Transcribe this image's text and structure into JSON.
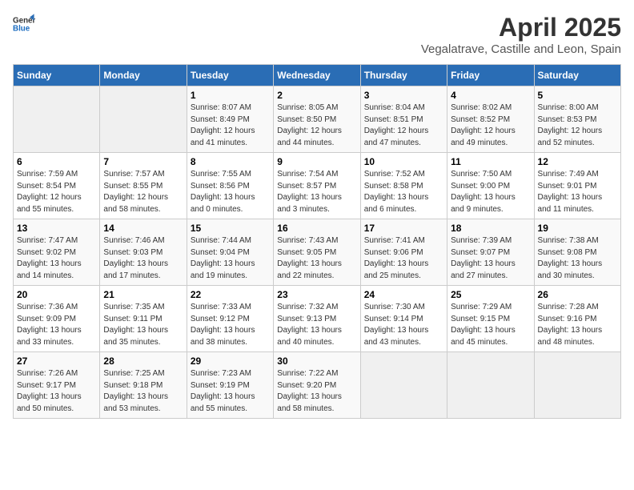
{
  "logo": {
    "general": "General",
    "blue": "Blue"
  },
  "header": {
    "month": "April 2025",
    "location": "Vegalatrave, Castille and Leon, Spain"
  },
  "weekdays": [
    "Sunday",
    "Monday",
    "Tuesday",
    "Wednesday",
    "Thursday",
    "Friday",
    "Saturday"
  ],
  "weeks": [
    [
      {
        "day": "",
        "sunrise": "",
        "sunset": "",
        "daylight": ""
      },
      {
        "day": "",
        "sunrise": "",
        "sunset": "",
        "daylight": ""
      },
      {
        "day": "1",
        "sunrise": "Sunrise: 8:07 AM",
        "sunset": "Sunset: 8:49 PM",
        "daylight": "Daylight: 12 hours and 41 minutes."
      },
      {
        "day": "2",
        "sunrise": "Sunrise: 8:05 AM",
        "sunset": "Sunset: 8:50 PM",
        "daylight": "Daylight: 12 hours and 44 minutes."
      },
      {
        "day": "3",
        "sunrise": "Sunrise: 8:04 AM",
        "sunset": "Sunset: 8:51 PM",
        "daylight": "Daylight: 12 hours and 47 minutes."
      },
      {
        "day": "4",
        "sunrise": "Sunrise: 8:02 AM",
        "sunset": "Sunset: 8:52 PM",
        "daylight": "Daylight: 12 hours and 49 minutes."
      },
      {
        "day": "5",
        "sunrise": "Sunrise: 8:00 AM",
        "sunset": "Sunset: 8:53 PM",
        "daylight": "Daylight: 12 hours and 52 minutes."
      }
    ],
    [
      {
        "day": "6",
        "sunrise": "Sunrise: 7:59 AM",
        "sunset": "Sunset: 8:54 PM",
        "daylight": "Daylight: 12 hours and 55 minutes."
      },
      {
        "day": "7",
        "sunrise": "Sunrise: 7:57 AM",
        "sunset": "Sunset: 8:55 PM",
        "daylight": "Daylight: 12 hours and 58 minutes."
      },
      {
        "day": "8",
        "sunrise": "Sunrise: 7:55 AM",
        "sunset": "Sunset: 8:56 PM",
        "daylight": "Daylight: 13 hours and 0 minutes."
      },
      {
        "day": "9",
        "sunrise": "Sunrise: 7:54 AM",
        "sunset": "Sunset: 8:57 PM",
        "daylight": "Daylight: 13 hours and 3 minutes."
      },
      {
        "day": "10",
        "sunrise": "Sunrise: 7:52 AM",
        "sunset": "Sunset: 8:58 PM",
        "daylight": "Daylight: 13 hours and 6 minutes."
      },
      {
        "day": "11",
        "sunrise": "Sunrise: 7:50 AM",
        "sunset": "Sunset: 9:00 PM",
        "daylight": "Daylight: 13 hours and 9 minutes."
      },
      {
        "day": "12",
        "sunrise": "Sunrise: 7:49 AM",
        "sunset": "Sunset: 9:01 PM",
        "daylight": "Daylight: 13 hours and 11 minutes."
      }
    ],
    [
      {
        "day": "13",
        "sunrise": "Sunrise: 7:47 AM",
        "sunset": "Sunset: 9:02 PM",
        "daylight": "Daylight: 13 hours and 14 minutes."
      },
      {
        "day": "14",
        "sunrise": "Sunrise: 7:46 AM",
        "sunset": "Sunset: 9:03 PM",
        "daylight": "Daylight: 13 hours and 17 minutes."
      },
      {
        "day": "15",
        "sunrise": "Sunrise: 7:44 AM",
        "sunset": "Sunset: 9:04 PM",
        "daylight": "Daylight: 13 hours and 19 minutes."
      },
      {
        "day": "16",
        "sunrise": "Sunrise: 7:43 AM",
        "sunset": "Sunset: 9:05 PM",
        "daylight": "Daylight: 13 hours and 22 minutes."
      },
      {
        "day": "17",
        "sunrise": "Sunrise: 7:41 AM",
        "sunset": "Sunset: 9:06 PM",
        "daylight": "Daylight: 13 hours and 25 minutes."
      },
      {
        "day": "18",
        "sunrise": "Sunrise: 7:39 AM",
        "sunset": "Sunset: 9:07 PM",
        "daylight": "Daylight: 13 hours and 27 minutes."
      },
      {
        "day": "19",
        "sunrise": "Sunrise: 7:38 AM",
        "sunset": "Sunset: 9:08 PM",
        "daylight": "Daylight: 13 hours and 30 minutes."
      }
    ],
    [
      {
        "day": "20",
        "sunrise": "Sunrise: 7:36 AM",
        "sunset": "Sunset: 9:09 PM",
        "daylight": "Daylight: 13 hours and 33 minutes."
      },
      {
        "day": "21",
        "sunrise": "Sunrise: 7:35 AM",
        "sunset": "Sunset: 9:11 PM",
        "daylight": "Daylight: 13 hours and 35 minutes."
      },
      {
        "day": "22",
        "sunrise": "Sunrise: 7:33 AM",
        "sunset": "Sunset: 9:12 PM",
        "daylight": "Daylight: 13 hours and 38 minutes."
      },
      {
        "day": "23",
        "sunrise": "Sunrise: 7:32 AM",
        "sunset": "Sunset: 9:13 PM",
        "daylight": "Daylight: 13 hours and 40 minutes."
      },
      {
        "day": "24",
        "sunrise": "Sunrise: 7:30 AM",
        "sunset": "Sunset: 9:14 PM",
        "daylight": "Daylight: 13 hours and 43 minutes."
      },
      {
        "day": "25",
        "sunrise": "Sunrise: 7:29 AM",
        "sunset": "Sunset: 9:15 PM",
        "daylight": "Daylight: 13 hours and 45 minutes."
      },
      {
        "day": "26",
        "sunrise": "Sunrise: 7:28 AM",
        "sunset": "Sunset: 9:16 PM",
        "daylight": "Daylight: 13 hours and 48 minutes."
      }
    ],
    [
      {
        "day": "27",
        "sunrise": "Sunrise: 7:26 AM",
        "sunset": "Sunset: 9:17 PM",
        "daylight": "Daylight: 13 hours and 50 minutes."
      },
      {
        "day": "28",
        "sunrise": "Sunrise: 7:25 AM",
        "sunset": "Sunset: 9:18 PM",
        "daylight": "Daylight: 13 hours and 53 minutes."
      },
      {
        "day": "29",
        "sunrise": "Sunrise: 7:23 AM",
        "sunset": "Sunset: 9:19 PM",
        "daylight": "Daylight: 13 hours and 55 minutes."
      },
      {
        "day": "30",
        "sunrise": "Sunrise: 7:22 AM",
        "sunset": "Sunset: 9:20 PM",
        "daylight": "Daylight: 13 hours and 58 minutes."
      },
      {
        "day": "",
        "sunrise": "",
        "sunset": "",
        "daylight": ""
      },
      {
        "day": "",
        "sunrise": "",
        "sunset": "",
        "daylight": ""
      },
      {
        "day": "",
        "sunrise": "",
        "sunset": "",
        "daylight": ""
      }
    ]
  ]
}
